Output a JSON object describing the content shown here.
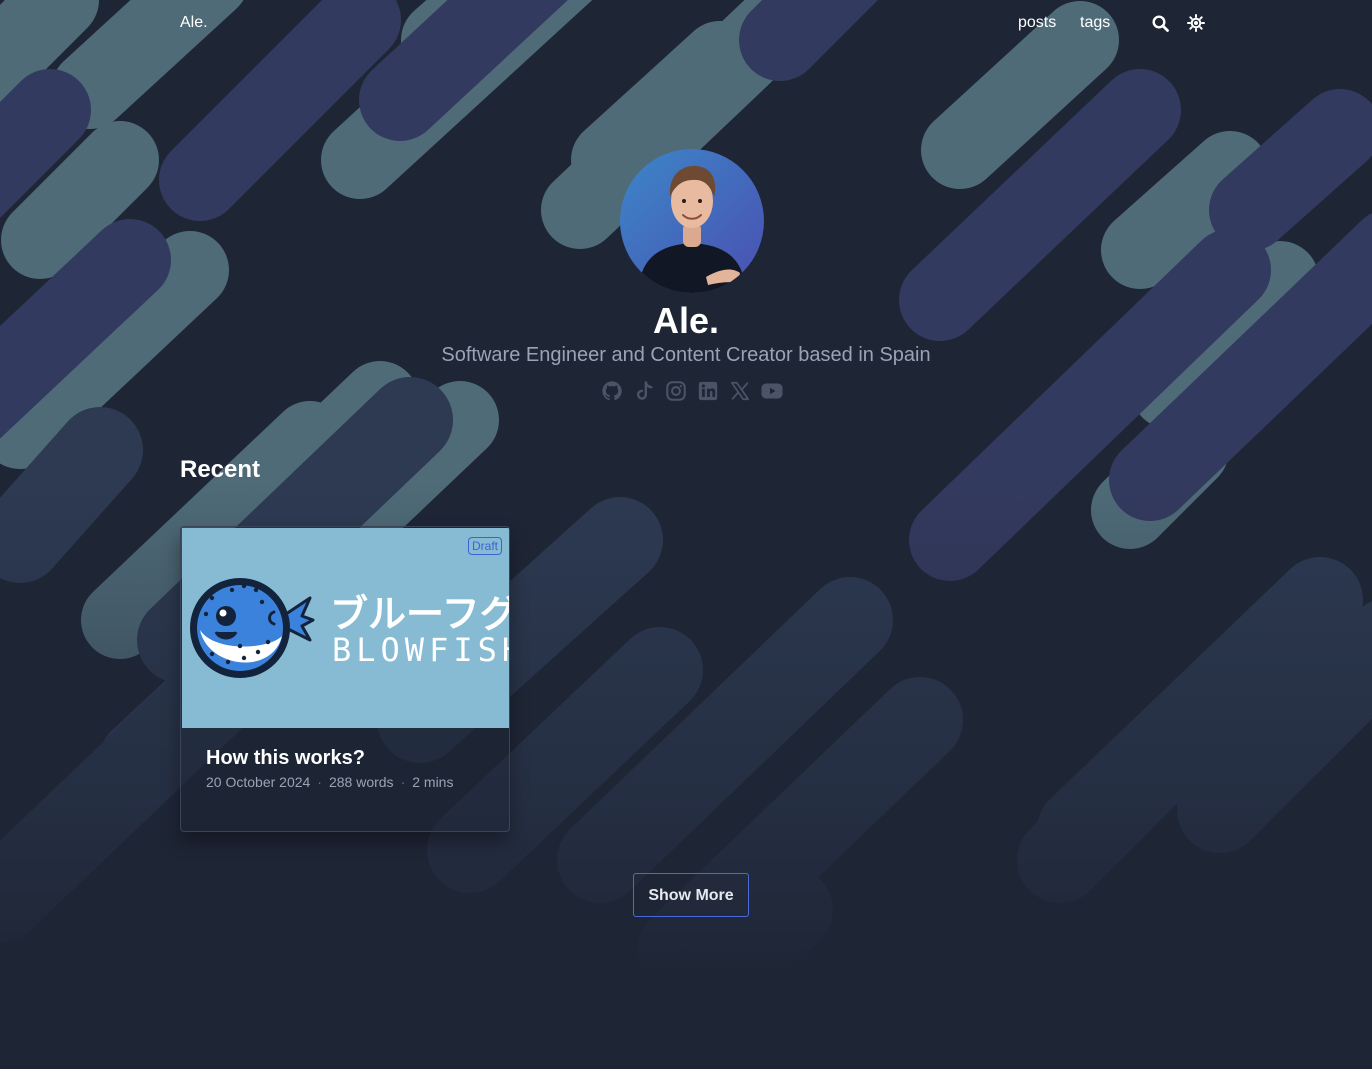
{
  "header": {
    "site_title": "Ale.",
    "nav": [
      {
        "label": "posts"
      },
      {
        "label": "tags"
      }
    ]
  },
  "hero": {
    "name": "Ale.",
    "bio": "Software Engineer and Content Creator based in Spain",
    "social_icons": [
      "github-icon",
      "tiktok-icon",
      "instagram-icon",
      "linkedin-icon",
      "x-icon",
      "youtube-icon"
    ]
  },
  "recent": {
    "heading": "Recent",
    "cards": [
      {
        "badge": "Draft",
        "thumbnail_jp": "ブルーフグ",
        "thumbnail_en": "BLOWFISH",
        "title": "How this works?",
        "date": "20 October 2024",
        "words": "288 words",
        "read_time": "2 mins"
      }
    ]
  },
  "show_more_label": "Show More",
  "colors": {
    "background": "#1e2535",
    "accent": "#4a69d8",
    "thumbnail_bg": "#86bbd3"
  }
}
